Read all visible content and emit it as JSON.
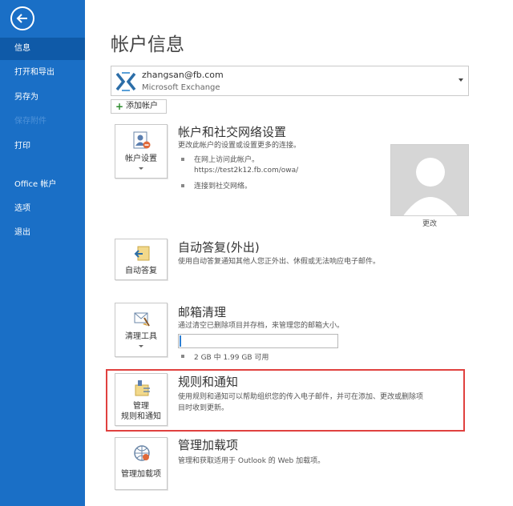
{
  "sidebar": {
    "items": [
      {
        "label": "信息",
        "state": "active"
      },
      {
        "label": "打开和导出",
        "state": "normal"
      },
      {
        "label": "另存为",
        "state": "normal"
      },
      {
        "label": "保存附件",
        "state": "disabled"
      },
      {
        "label": "打印",
        "state": "normal"
      },
      {
        "label": "Office 帐户",
        "state": "normal"
      },
      {
        "label": "选项",
        "state": "normal"
      },
      {
        "label": "退出",
        "state": "normal"
      }
    ]
  },
  "main": {
    "title": "帐户信息",
    "account": {
      "email": "zhangsan@fb.com",
      "type": "Microsoft Exchange"
    },
    "add_account_label": "添加帐户",
    "sections": {
      "account_settings": {
        "tile_label": "帐户设置",
        "title": "帐户和社交网络设置",
        "desc": "更改此帐户的设置或设置更多的连接。",
        "bullet1": "在网上访问此帐户。",
        "link": "https://test2k12.fb.com/owa/",
        "bullet2": "连接到社交网络。",
        "change_label": "更改"
      },
      "auto_reply": {
        "tile_label": "自动答复",
        "title": "自动答复(外出)",
        "desc": "使用自动答复通知其他人您正外出、休假或无法响应电子邮件。"
      },
      "mailbox": {
        "tile_label": "清理工具",
        "title": "邮箱清理",
        "desc": "通过清空已删除项目并存档，来管理您的邮箱大小。",
        "usage": "2 GB 中 1.99 GB 可用",
        "free_fraction": 0.005
      },
      "rules": {
        "tile_label_1": "管理",
        "tile_label_2": "规则和通知",
        "title": "规则和通知",
        "desc_1": "使用规则和通知可以帮助组织您的传入电子邮件，并可在添加、更改或删除项",
        "desc_2": "目时收到更新。"
      },
      "addins": {
        "tile_label": "管理加载项",
        "title": "管理加载项",
        "desc": "管理和获取适用于 Outlook 的 Web 加载项。"
      }
    }
  },
  "colors": {
    "sidebar": "#1a6fc6",
    "sidebar_active": "#0f5aa8",
    "highlight": "#e0413f",
    "progress": "#2c7fd4"
  }
}
